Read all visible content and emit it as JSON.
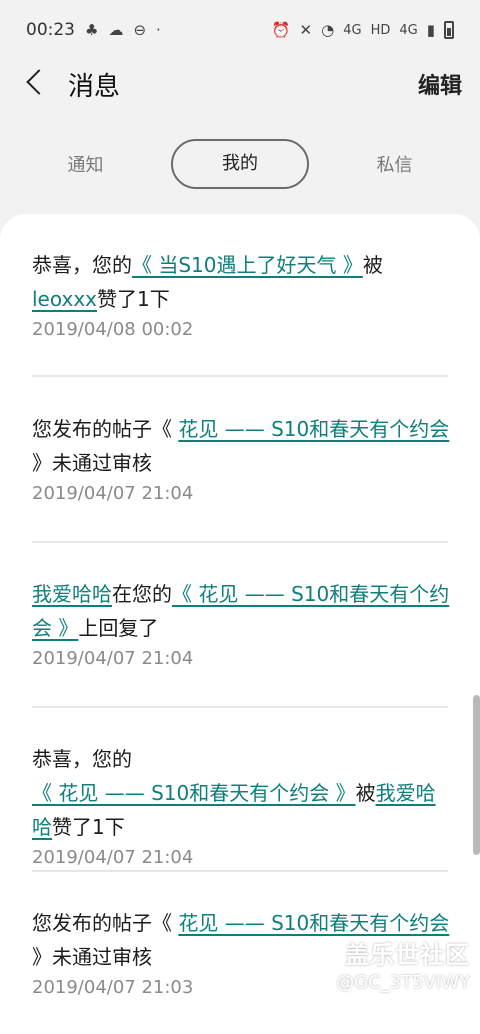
{
  "status_bar": {
    "time": "00:23",
    "icons": [
      "notification-icon",
      "weather-icon",
      "do-not-disturb-icon",
      "alarm-icon",
      "mute-icon",
      "wifi-icon",
      "signal-icon",
      "battery-icon"
    ],
    "network_label_1": "4G",
    "hd_label": "HD",
    "network_label_2": "4G"
  },
  "header": {
    "title": "消息",
    "edit_label": "编辑"
  },
  "tabs": [
    {
      "label": "通知",
      "active": false
    },
    {
      "label": "我的",
      "active": true
    },
    {
      "label": "私信",
      "active": false
    }
  ],
  "messages": [
    {
      "p1": "恭喜，您的",
      "link1": "《 当S10遇上了好天气 》",
      "p2": "被",
      "link2": "leoxxx",
      "p3": "赞了1下",
      "time": "2019/04/08 00:02"
    },
    {
      "p1": "您发布的帖子《 ",
      "link1": "花见 —— S10和春天有个约会",
      "p2": " 》未通过审核",
      "time": "2019/04/07 21:04"
    },
    {
      "link0": "我爱哈哈",
      "p1": "在您的",
      "link1": "《 花见 —— S10和春天有个约会 》",
      "p2": "上回复了",
      "time": "2019/04/07 21:04"
    },
    {
      "p1": "恭喜，您的",
      "link1": "《 花见 —— S10和春天有个约会 》",
      "p2": "被",
      "link2": "我爱哈哈",
      "p3": "赞了1下",
      "time": "2019/04/07 21:04"
    },
    {
      "p1": "您发布的帖子《 ",
      "link1": "花见 —— S10和春天有个约会",
      "p2": " 》未通过审核",
      "time": "2019/04/07 21:03"
    }
  ],
  "watermark": {
    "logo": "盖乐世社区",
    "user": "@GC_3T5VIWY"
  },
  "colors": {
    "link": "#0e7f7a",
    "background": "#f2f2f2",
    "card": "#ffffff"
  }
}
